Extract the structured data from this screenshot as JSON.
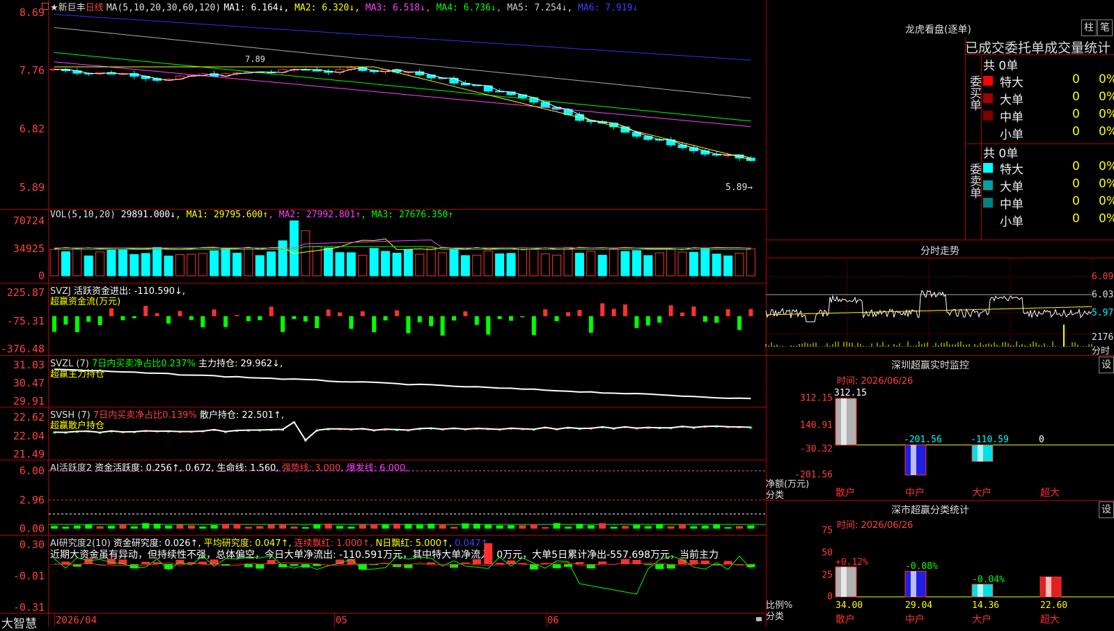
{
  "app": {
    "brand": "大智慧"
  },
  "stock": {
    "name": "★新巨丰",
    "period": "日线"
  },
  "kline": {
    "ma_label": "MA(5,10,20,30,60,120)",
    "ma": [
      {
        "name": "MA1:",
        "value": "6.164↓",
        "color": "#ffffff"
      },
      {
        "name": "MA2:",
        "value": "6.320↓",
        "color": "#ffff00"
      },
      {
        "name": "MA3:",
        "value": "6.518↓",
        "color": "#ff40ff"
      },
      {
        "name": "MA4:",
        "value": "6.736↓",
        "color": "#00ff00"
      },
      {
        "name": "MA5:",
        "value": "7.254↓",
        "color": "#cccccc"
      },
      {
        "name": "MA6:",
        "value": "7.919↓",
        "color": "#4040ff"
      }
    ],
    "yticks": [
      "8.69",
      "7.76",
      "6.82",
      "5.89"
    ],
    "high_label": "7.89",
    "low_label": "5.89→"
  },
  "vol": {
    "label": "VOL(5,10,20)",
    "value": "29891.000↓",
    "ma": [
      {
        "name": "MA1:",
        "value": "29795.600↑",
        "color": "#ffff00"
      },
      {
        "name": "MA2:",
        "value": "27992.801↑",
        "color": "#ff40ff"
      },
      {
        "name": "MA3:",
        "value": "27676.350↑",
        "color": "#00ff00"
      }
    ],
    "yticks": [
      "70724",
      "34925",
      "0"
    ]
  },
  "svzj": {
    "title": "SVZJ",
    "label": "活跃资金进出:",
    "value": "-110.590↓,",
    "sub": "超赢资金流(万元)",
    "yticks": [
      "225.87",
      "-75.31",
      "-376.48"
    ]
  },
  "svzl": {
    "title": "SVZL (7)",
    "ratio": "7日内买卖净占比0.237%",
    "label": "主力持仓:",
    "value": "29.962↓,",
    "sub": "超赢主力持仓",
    "yticks": [
      "31.03",
      "30.47",
      "29.91"
    ]
  },
  "svsh": {
    "title": "SVSH (7)",
    "ratio": "7日内买卖净占比0.139%",
    "label": "散户持仓:",
    "value": "22.501↑,",
    "sub": "超赢散户持仓",
    "yticks": [
      "22.62",
      "22.04",
      "21.49"
    ]
  },
  "ai_active": {
    "title": "AI活跃度2",
    "label": "资金活跃度:",
    "v1": "0.256↑,",
    "v2": "0.672,",
    "life": "生命线: 1.560,",
    "strong": "强势线: 3.000,",
    "burst": "爆发线: 6.000,",
    "yticks": [
      "6.00",
      "2.96",
      "0.00"
    ]
  },
  "ai_research": {
    "title": "AI研究度2(10)",
    "label": "资金研究度: 0.026↑,",
    "avg": "平均研究度: 0.047↑,",
    "cont": "连续飘红: 1.000↑,",
    "nday": "N日飘红: 5.000↑,",
    "last": "0.047↑",
    "text": "近期大资金虽有异动，但持续性不强，总体偏空，今日大单净流出: -110.591万元，其中特大单净流入: 0万元，大单5日累计净出-557.698万元，当前主力",
    "yticks": [
      "0.30",
      "-0.01",
      "-0.31"
    ]
  },
  "xaxis": {
    "labels": [
      "2026/04",
      "05",
      "06"
    ]
  },
  "dragon": {
    "title": "龙虎看盘(逐单)",
    "btn1": "柱",
    "btn2": "笔",
    "subtitle": "已成交委托单成交量统计",
    "buy": {
      "group": "委买单",
      "total": "共 0单",
      "rows": [
        {
          "label": "特大",
          "v1": "0",
          "v2": "0%",
          "color": "#ff0000"
        },
        {
          "label": "大单",
          "v1": "0",
          "v2": "0%",
          "color": "#a00000"
        },
        {
          "label": "中单",
          "v1": "0",
          "v2": "0%",
          "color": "#800000"
        },
        {
          "label": "小单",
          "v1": "0",
          "v2": "0%",
          "color": "#000000"
        }
      ]
    },
    "sell": {
      "group": "委卖单",
      "total": "共 0单",
      "rows": [
        {
          "label": "特大",
          "v1": "0",
          "v2": "0%",
          "color": "#00ffff"
        },
        {
          "label": "大单",
          "v1": "0",
          "v2": "0%",
          "color": "#00a0a0"
        },
        {
          "label": "中单",
          "v1": "0",
          "v2": "0%",
          "color": "#008080"
        },
        {
          "label": "小单",
          "v1": "0",
          "v2": "0%",
          "color": "#000000"
        }
      ]
    }
  },
  "intraday": {
    "title": "分时走势",
    "yticks": [
      "6.09",
      "6.03",
      "5.97"
    ],
    "vol_label": "2176",
    "bottom_label": "分时"
  },
  "monitor": {
    "title": "深圳超赢实时监控",
    "btn": "设",
    "time": "时间: 2026/06/26",
    "unit1": "净额(万元)",
    "unit2": "分类",
    "yticks": [
      "312.15",
      "140.91",
      "-30.32",
      "-201.56"
    ]
  },
  "classify": {
    "title": "深市超赢分类统计",
    "btn": "设",
    "time": "时间: 2026/06/26",
    "unit1": "比例%",
    "unit2": "分类",
    "yticks": [
      "75",
      "50",
      "25",
      "0"
    ]
  },
  "chart_data": [
    {
      "type": "bar",
      "title": "深圳超赢实时监控",
      "categories": [
        "散户",
        "中户",
        "大户",
        "超大"
      ],
      "values": [
        312.15,
        -201.56,
        -110.59,
        0
      ],
      "ylabel": "净额(万元)",
      "ylim": [
        -201.56,
        312.15
      ]
    },
    {
      "type": "bar",
      "title": "深市超赢分类统计",
      "categories": [
        "散户",
        "中户",
        "大户",
        "超大"
      ],
      "values": [
        34.0,
        29.04,
        14.36,
        22.6
      ],
      "changes": [
        "+0.12%",
        "-0.08%",
        "-0.04%",
        ""
      ],
      "ylabel": "比例%",
      "ylim": [
        0,
        75
      ]
    }
  ]
}
